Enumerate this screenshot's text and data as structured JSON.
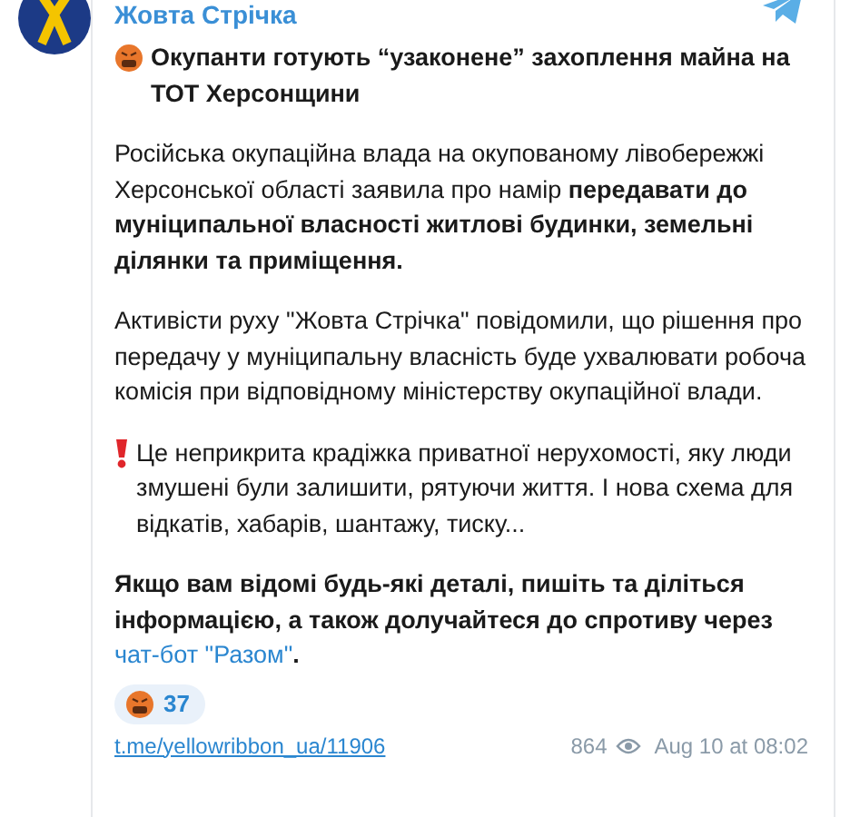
{
  "channel": {
    "name": "Жовта Стрічка"
  },
  "post": {
    "title": "Окупанти готують “узаконене” захоплення майна на ТОТ Херсонщини",
    "paragraphs": [
      {
        "kind": "text",
        "text": "Російська окупаційна влада на окупованому лівобережжі Херсонської області заявила про намір **передавати до муніципальної власності житлові будинки, земельні ділянки та приміщення.**"
      },
      {
        "kind": "text",
        "text": "Активісти руху \"Жовта Стрічка\" повідомили, що рішення про передачу у муніципальну власність буде ухвалювати робоча комісія при відповідному міністерству окупаційної влади."
      },
      {
        "kind": "alert",
        "text": "Це неприкрита крадіжка приватної нерухомості, яку люди змушені були залишити, рятуючи життя. І нова схема для відкатів, хабарів, шантажу, тиску..."
      },
      {
        "kind": "cta",
        "text": "Якщо вам відомі будь-які деталі, пишіть та діліться інформацією, а також долучайтеся до спротиву через",
        "link": "чат-бот \"Разом\"",
        "after": "."
      }
    ],
    "reaction": {
      "count": "37"
    },
    "footer": {
      "link": "t.me/yellowribbon_ua/11906",
      "views": "864",
      "date": "Aug 10 at 08:02"
    }
  }
}
